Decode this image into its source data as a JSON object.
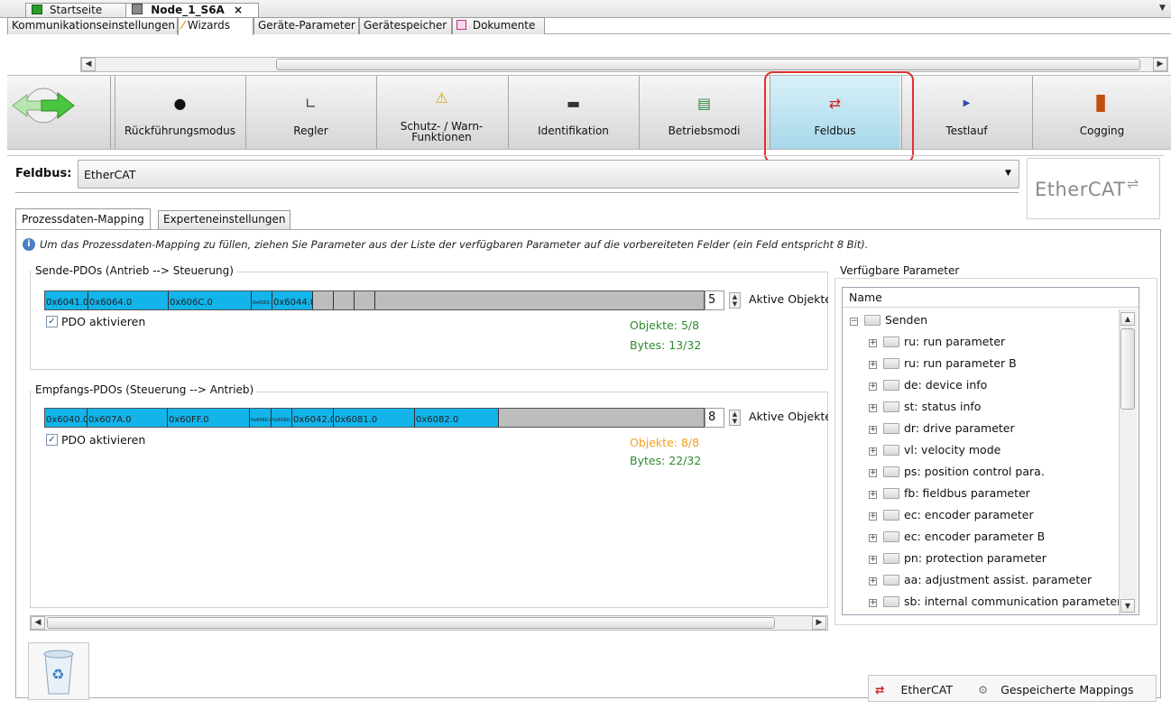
{
  "document_tabs": [
    {
      "label": "Startseite",
      "icon": "start-page-icon"
    },
    {
      "label": "Node_1_S6A",
      "icon": "drive-icon",
      "close": "×"
    }
  ],
  "sub_tabs": [
    {
      "label": "Kommunikationseinstellungen"
    },
    {
      "label": "Wizards"
    },
    {
      "label": "Geräte-Parameter"
    },
    {
      "label": "Gerätespeicher"
    },
    {
      "label": "Dokumente"
    }
  ],
  "wizard_steps": [
    {
      "label": "Rückführungsmodus",
      "icon": "feedback-icon"
    },
    {
      "label": "Regler",
      "icon": "controller-curve-icon"
    },
    {
      "label_line1": "Schutz- / Warn-",
      "label_line2": "Funktionen",
      "icon": "warning-icon"
    },
    {
      "label": "Identifikation",
      "icon": "identification-icon"
    },
    {
      "label": "Betriebsmodi",
      "icon": "operating-modes-icon"
    },
    {
      "label": "Feldbus",
      "icon": "fieldbus-arrows-icon",
      "active": true
    },
    {
      "label": "Testlauf",
      "icon": "play-icon"
    },
    {
      "label": "Cogging",
      "icon": "cogging-chart-icon"
    }
  ],
  "fieldbus": {
    "label": "Feldbus:",
    "selected": "EtherCAT",
    "logo_text": "EtherCAT"
  },
  "inner_tabs": [
    {
      "label": "Prozessdaten-Mapping"
    },
    {
      "label": "Experteneinstellungen"
    }
  ],
  "info_text": "Um das Prozessdaten-Mapping zu füllen, ziehen Sie Parameter aus der Liste der verfügbaren Parameter auf die vorbereiteten Felder (ein Feld entspricht 8 Bit).",
  "send_pdos": {
    "title": "Sende-PDOs (Antrieb --> Steuerung)",
    "cells": [
      "0x6041.0",
      "0x6064.0",
      "0x606C.0",
      "0x6061.0",
      "0x6044.0"
    ],
    "count": "5",
    "count_label": "Aktive Objekte",
    "activate_label": "PDO aktivieren",
    "objects": "Objekte: 5/8",
    "bytes": "Bytes: 13/32",
    "objects_color": "#2e8b2e"
  },
  "recv_pdos": {
    "title": "Empfangs-PDOs (Steuerung --> Antrieb)",
    "cells": [
      "0x6040.0",
      "0x607A.0",
      "0x60FF.0",
      "0x6060.0",
      "0x6060.0",
      "0x6042.0",
      "0x6081.0",
      "0x6082.0"
    ],
    "count": "8",
    "count_label": "Aktive Objekte",
    "activate_label": "PDO aktivieren",
    "objects": "Objekte: 8/8",
    "bytes": "Bytes: 22/32",
    "objects_color": "#f0a020"
  },
  "params": {
    "title": "Verfügbare Parameter",
    "column": "Name",
    "root": "Senden",
    "items": [
      "ru: run parameter",
      "ru: run parameter B",
      "de: device info",
      "st: status info",
      "dr: drive parameter",
      "vl: velocity mode",
      "ps: position control para.",
      "fb: fieldbus parameter",
      "ec: encoder parameter",
      "ec: encoder parameter B",
      "pn: protection parameter",
      "aa: adjustment assist. parameter",
      "sb: internal communication parameter"
    ]
  },
  "bottom_tabs": [
    {
      "label": "EtherCAT",
      "icon": "ethercat-icon"
    },
    {
      "label": "Gespeicherte Mappings",
      "icon": "saved-mappings-icon"
    }
  ],
  "colors": {
    "pdo_cell": "#12b4ea",
    "accent_green": "#2e8b2e",
    "highlight_red": "#e03030"
  }
}
